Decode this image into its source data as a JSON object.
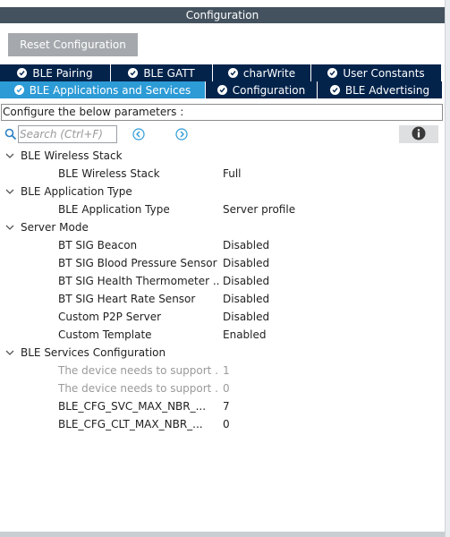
{
  "window": {
    "title": "Configuration"
  },
  "reset_button": {
    "label": "Reset Configuration"
  },
  "tabs_row1": [
    {
      "label": "BLE Pairing",
      "active": false
    },
    {
      "label": "BLE GATT",
      "active": false
    },
    {
      "label": "charWrite",
      "active": false
    },
    {
      "label": "User Constants",
      "active": false
    }
  ],
  "tabs_row2": [
    {
      "label": "BLE Applications and Services",
      "active": true
    },
    {
      "label": "Configuration",
      "active": false
    },
    {
      "label": "BLE Advertising",
      "active": false
    }
  ],
  "hint": "Configure the below parameters :",
  "search": {
    "placeholder": "Search (Ctrl+F)"
  },
  "tree": [
    {
      "group": "BLE Wireless Stack",
      "items": [
        {
          "name": "BLE Wireless Stack",
          "value": "Full"
        }
      ]
    },
    {
      "group": "BLE Application Type",
      "items": [
        {
          "name": "BLE Application Type",
          "value": "Server profile"
        }
      ]
    },
    {
      "group": "Server Mode",
      "items": [
        {
          "name": "BT SIG Beacon",
          "value": "Disabled"
        },
        {
          "name": "BT SIG Blood Pressure Sensor",
          "value": "Disabled"
        },
        {
          "name": "BT SIG Health Thermometer ...",
          "value": "Disabled"
        },
        {
          "name": "BT SIG Heart Rate Sensor",
          "value": "Disabled"
        },
        {
          "name": "Custom P2P Server",
          "value": "Disabled"
        },
        {
          "name": "Custom Template",
          "value": "Enabled"
        }
      ]
    },
    {
      "group": "BLE Services Configuration",
      "items": [
        {
          "name": "The device needs to support ...",
          "value": "1",
          "disabled": true
        },
        {
          "name": "The device needs to support ...",
          "value": "0",
          "disabled": true
        },
        {
          "name": "BLE_CFG_SVC_MAX_NBR_...",
          "value": "7"
        },
        {
          "name": "BLE_CFG_CLT_MAX_NBR_...",
          "value": "0"
        }
      ]
    }
  ],
  "colors": {
    "tab_dark": "#03234b",
    "tab_active": "#2c9bd6",
    "title_bar": "#44525f"
  },
  "icons": {
    "search": "search-icon",
    "prev": "previous-occurrence-icon",
    "next": "next-occurrence-icon",
    "info": "info-icon",
    "tab_check": "check-circle-icon",
    "group_toggle": "chevron-down-icon"
  }
}
